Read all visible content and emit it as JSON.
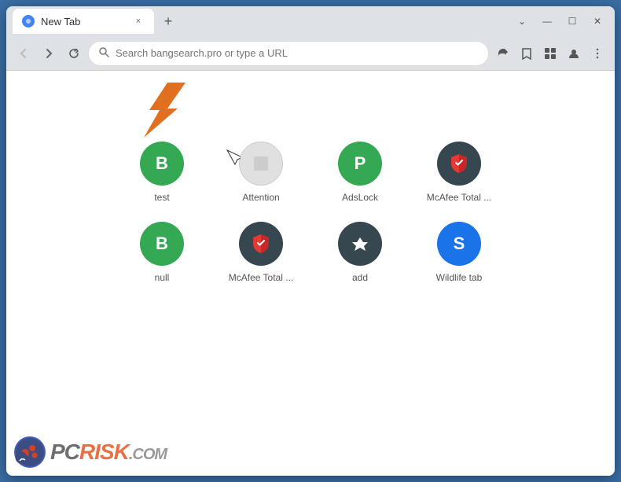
{
  "browser": {
    "tab": {
      "title": "New Tab",
      "favicon": "🌐",
      "close_label": "×"
    },
    "new_tab_btn": "+",
    "window_controls": {
      "minimize": "—",
      "maximize": "☐",
      "close": "✕",
      "chevron_down": "⌄"
    },
    "toolbar": {
      "back_label": "←",
      "forward_label": "→",
      "reload_label": "↻",
      "address_placeholder": "Search bangsearch.pro or type a URL",
      "share_label": "⬆",
      "star_label": "☆",
      "extensions_label": "▣",
      "profile_label": "👤",
      "menu_label": "⋮"
    }
  },
  "apps": [
    {
      "id": "test",
      "label": "test",
      "icon_type": "green",
      "icon_letter": "B"
    },
    {
      "id": "attention",
      "label": "Attention",
      "icon_type": "gray",
      "icon_letter": ""
    },
    {
      "id": "adslock",
      "label": "AdsLock",
      "icon_type": "green",
      "icon_letter": "P"
    },
    {
      "id": "mcafee1",
      "label": "McAfee Total ...",
      "icon_type": "mcafee",
      "icon_letter": ""
    },
    {
      "id": "null",
      "label": "null",
      "icon_type": "green",
      "icon_letter": "B"
    },
    {
      "id": "mcafee2",
      "label": "McAfee Total ...",
      "icon_type": "mcafee2",
      "icon_letter": ""
    },
    {
      "id": "add",
      "label": "add",
      "icon_type": "dark",
      "icon_letter": "+"
    },
    {
      "id": "wildlife",
      "label": "Wildlife tab",
      "icon_type": "wildlife-s",
      "icon_letter": "S"
    }
  ],
  "watermark": {
    "text_pc": "PC",
    "text_risk": "RISK",
    "text_dot": ".",
    "text_com": "COM"
  }
}
